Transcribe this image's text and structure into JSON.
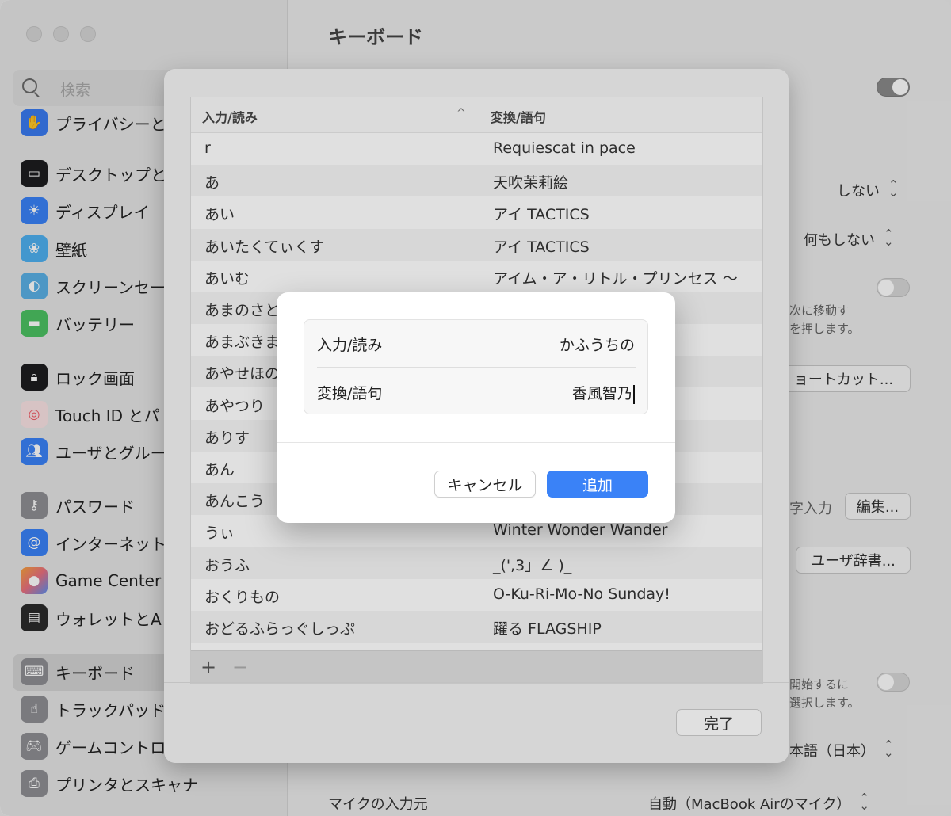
{
  "window": {
    "title": "キーボード"
  },
  "sidebar": {
    "search_placeholder": "検索",
    "items": [
      {
        "label": "プライバシーと",
        "icon": "hand-icon",
        "color": "#3a7bf0"
      },
      {
        "label": "デスクトップと",
        "icon": "desktop-icon",
        "color": "#1d1d1f"
      },
      {
        "label": "ディスプレイ",
        "icon": "sun-icon",
        "color": "#3a82f7"
      },
      {
        "label": "壁紙",
        "icon": "flower-icon",
        "color": "#4fb0f0"
      },
      {
        "label": "スクリーンセー",
        "icon": "screensaver-icon",
        "color": "#5ab0e6"
      },
      {
        "label": "バッテリー",
        "icon": "battery-icon",
        "color": "#4cc262"
      },
      {
        "label": "ロック画面",
        "icon": "lock-icon",
        "color": "#1d1d1f"
      },
      {
        "label": "Touch ID とパ",
        "icon": "fingerprint-icon",
        "color": "#f25c66"
      },
      {
        "label": "ユーザとグルー",
        "icon": "users-icon",
        "color": "#3a82f7"
      },
      {
        "label": "パスワード",
        "icon": "key-icon",
        "color": "#8e8e93"
      },
      {
        "label": "インターネット",
        "icon": "at-icon",
        "color": "#3a82f7"
      },
      {
        "label": "Game Center",
        "icon": "game-center-icon",
        "color": "#e9707f"
      },
      {
        "label": "ウォレットとA",
        "icon": "wallet-icon",
        "color": "#2b2b2b"
      },
      {
        "label": "キーボード",
        "icon": "keyboard-icon",
        "color": "#8e8e93"
      },
      {
        "label": "トラックパッド",
        "icon": "trackpad-icon",
        "color": "#8e8e93"
      },
      {
        "label": "ゲームコントロ",
        "icon": "gamepad-icon",
        "color": "#8e8e93"
      },
      {
        "label": "プリンタとスキャナ",
        "icon": "printer-icon",
        "color": "#8e8e93"
      }
    ]
  },
  "main": {
    "fragments": {
      "popup1": "しない",
      "popup2": "何もしない",
      "text1": "次に移動す",
      "text2": "を押します。",
      "shortcut_button": "ョートカット...",
      "text3": "字入力",
      "edit_button": "編集...",
      "user_dict_button": "ユーザ辞書...",
      "text4": "開始するに",
      "text5": "選択します。",
      "language_popup": "本語（日本）",
      "mic_label": "マイクの入力元",
      "mic_value": "自動（MacBook Airのマイク）"
    }
  },
  "sheet": {
    "columns": {
      "reading": "入力/読み",
      "phrase": "変換/語句"
    },
    "rows": [
      {
        "reading": "r",
        "phrase": "Requiescat in pace"
      },
      {
        "reading": "あ",
        "phrase": "天吹茉莉絵"
      },
      {
        "reading": "あい",
        "phrase": "アイ TACTICS"
      },
      {
        "reading": "あいたくてぃくす",
        "phrase": "アイ TACTICS"
      },
      {
        "reading": "あいむ",
        "phrase": "アイム・ア・リトル・プリンセス 〜"
      },
      {
        "reading": "あまのさと",
        "phrase": ""
      },
      {
        "reading": "あまぶきま",
        "phrase": ""
      },
      {
        "reading": "あやせほの",
        "phrase": ""
      },
      {
        "reading": "あやつり",
        "phrase": ""
      },
      {
        "reading": "ありす",
        "phrase": ""
      },
      {
        "reading": "あん",
        "phrase": ""
      },
      {
        "reading": "あんこう",
        "phrase": ""
      },
      {
        "reading": "うぃ",
        "phrase": "Winter Wonder Wander"
      },
      {
        "reading": "おうふ",
        "phrase": "_(',3」∠ )_"
      },
      {
        "reading": "おくりもの",
        "phrase": "O-Ku-Ri-Mo-No Sunday!"
      },
      {
        "reading": "おどるふらっぐしっぷ",
        "phrase": "躍る FLAGSHIP"
      }
    ],
    "add_symbol": "+",
    "remove_symbol": "−",
    "done_button": "完了"
  },
  "dialog": {
    "reading_label": "入力/読み",
    "reading_value": "かふうちの",
    "phrase_label": "変換/語句",
    "phrase_value": "香風智乃",
    "cancel_button": "キャンセル",
    "add_button": "追加",
    "accent_color": "#3a82f7"
  }
}
